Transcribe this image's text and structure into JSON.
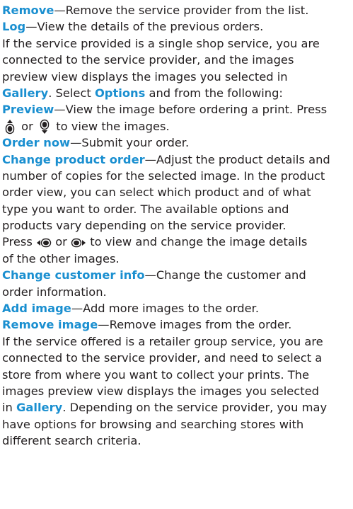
{
  "accent_color": "#1a8fd0",
  "text": {
    "l1_k": "Remove",
    "l1_t": "—Remove the service provider from the list.",
    "l2_k": "Log",
    "l2_t": "—View the details of the previous orders.",
    "l3": "If the service provided is a single shop service, you are",
    "l4": "connected to the service provider, and the images",
    "l5": "preview view displays the images you selected in",
    "l6_k": "Gallery",
    "l6_t": ". Select ",
    "l6_k2": "Options",
    "l6_t2": " and from the following:",
    "l7_k": "Preview",
    "l7_t": "—View the image before ordering a print. Press",
    "l8_or": " or ",
    "l8_t": " to view the images.",
    "l9_k": "Order now",
    "l9_t": "—Submit your order.",
    "l10_k": "Change product order",
    "l10_t": "—Adjust the product details and",
    "l11": "number of copies for the selected image. In the product",
    "l12": "order view, you can select which product and of what",
    "l13": "type you want to order. The available options and",
    "l14": "products vary depending on the service provider.",
    "l15_a": "Press ",
    "l15_or": " or ",
    "l15_t": " to view and change the image details",
    "l16": "of the other images.",
    "l17_k": "Change customer info",
    "l17_t": "—Change the customer and",
    "l18": "order information.",
    "l19_k": "Add image",
    "l19_t": "—Add more images to the order.",
    "l20_k": "Remove image",
    "l20_t": "—Remove images from the order.",
    "l21": "If the service offered is a retailer group service, you are",
    "l22": "connected to the service provider, and need to select a",
    "l23": "store from where you want to collect your prints. The",
    "l24": "images preview view displays the images you selected",
    "l25_a": "in ",
    "l25_k": "Gallery",
    "l25_t": ". Depending on the service provider, you may",
    "l26": "have options for browsing and searching stores with",
    "l27": "different search criteria."
  },
  "icons": {
    "up": "joystick-up-icon",
    "down": "joystick-down-icon",
    "left": "joystick-left-icon",
    "right": "joystick-right-icon"
  }
}
